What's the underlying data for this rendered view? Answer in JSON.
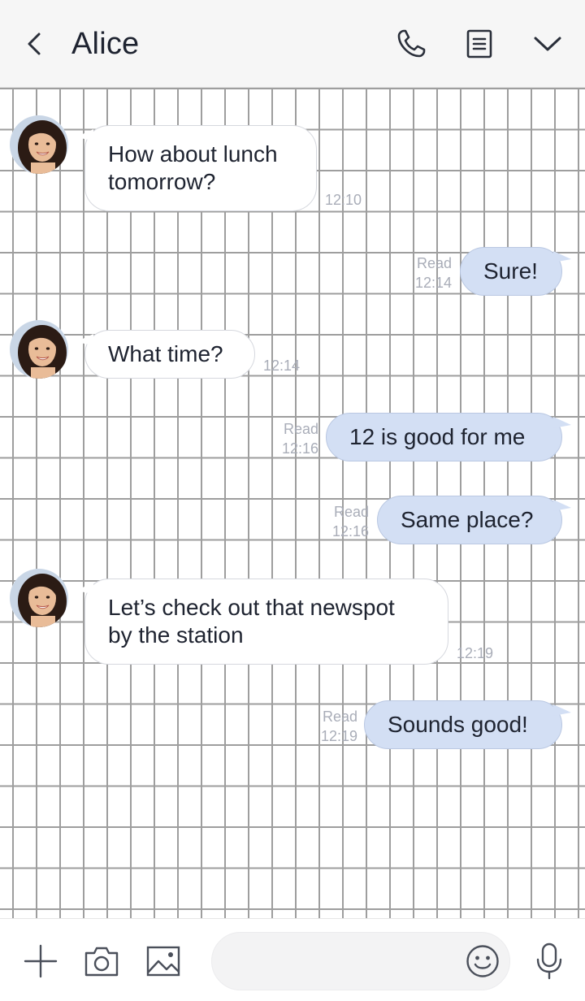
{
  "header": {
    "title": "Alice",
    "back_icon": "chevron-left-icon",
    "call_icon": "phone-icon",
    "notes_icon": "notes-icon",
    "menu_icon": "chevron-down-icon"
  },
  "messages": [
    {
      "side": "in",
      "line1": "How about lunch",
      "line2": "tomorrow?",
      "time": "12:10"
    },
    {
      "side": "out",
      "text": "Sure!",
      "read": "Read",
      "time": "12:14"
    },
    {
      "side": "in",
      "text": "What time?",
      "time": "12:14"
    },
    {
      "side": "out",
      "text": "12 is good for me",
      "read": "Read",
      "time": "12:16"
    },
    {
      "side": "out",
      "text": "Same place?",
      "read": "Read",
      "time": "12:16"
    },
    {
      "side": "in",
      "line1": "Let’s check out that newspot",
      "line2": "by the station",
      "time": "12:19"
    },
    {
      "side": "out",
      "text": "Sounds good!",
      "read": "Read",
      "time": "12:19"
    }
  ],
  "footer": {
    "input_value": "",
    "input_placeholder": "",
    "icons": [
      "plus-icon",
      "camera-icon",
      "image-icon",
      "emoji-icon",
      "microphone-icon"
    ]
  },
  "colors": {
    "header_bg": "#f6f6f6",
    "grid_line": "#9e9e9e",
    "outgoing_bubble": "#d3dff4",
    "incoming_bubble": "#ffffff",
    "meta_text": "#a9adb8",
    "text": "#1e2330"
  }
}
